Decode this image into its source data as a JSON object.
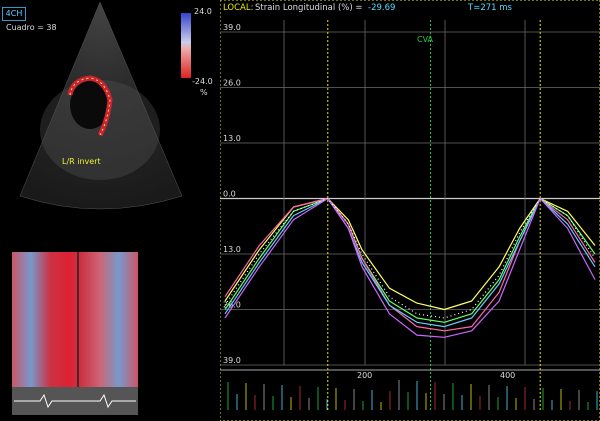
{
  "left": {
    "view_label": "4CH",
    "frame_label": "Cuadro = 38",
    "color_scale_top": "24.0",
    "color_scale_bottom": "-24.0",
    "color_scale_unit": "%",
    "overlay_label": "L/R invert"
  },
  "graph": {
    "header_mode": "LOCAL:",
    "header_metric": "Strain Longitudinal (%) =",
    "header_value": "-29.69",
    "header_time": "T=271 ms",
    "marker_label": "CVA",
    "colors": {
      "accent": "#e8e800",
      "marker": "#22cc44",
      "grid": "#6b6b6b"
    }
  },
  "chart_data": {
    "type": "line",
    "ylabel": "Strain Longitudinal (%)",
    "yticks": [
      "39.0",
      "26.0",
      "13.0",
      "0.0",
      "13.0",
      "26.0",
      "39.0"
    ],
    "xticks": [
      "200",
      "400"
    ],
    "x": [
      0,
      50,
      100,
      150,
      180,
      200,
      240,
      280,
      320,
      360,
      400,
      430,
      460,
      500,
      540
    ],
    "series": [
      {
        "color": "#ffff66",
        "values": [
          -24,
          -12,
          -2,
          0,
          -5,
          -12,
          -21,
          -24.5,
          -26,
          -24,
          -16,
          -7,
          0,
          -3,
          -11
        ]
      },
      {
        "color": "#66ff66",
        "values": [
          -26,
          -14,
          -3,
          0,
          -6,
          -14,
          -24,
          -28,
          -29,
          -27,
          -19,
          -9,
          0,
          -4,
          -13
        ]
      },
      {
        "color": "#ff66aa",
        "values": [
          -23,
          -11,
          -2,
          0,
          -6,
          -14,
          -25,
          -30,
          -31,
          -30,
          -22,
          -10,
          0,
          -5,
          -15
        ]
      },
      {
        "color": "#66ccff",
        "values": [
          -27,
          -15,
          -4,
          0,
          -7,
          -15,
          -25,
          -29,
          -30,
          -28,
          -20,
          -10,
          0,
          -6,
          -16
        ]
      },
      {
        "color": "#cc66ff",
        "values": [
          -28,
          -16,
          -5,
          0,
          -7,
          -16,
          -27,
          -32,
          -32.5,
          -31,
          -24,
          -12,
          0,
          -7,
          -19
        ]
      },
      {
        "color": "#ffffff",
        "values": [
          -25,
          -13,
          -3,
          0,
          -6,
          -13,
          -23,
          -27,
          -28,
          -26,
          -18,
          -8,
          0,
          -4,
          -14
        ]
      }
    ],
    "ylim": [
      -39,
      39
    ]
  }
}
